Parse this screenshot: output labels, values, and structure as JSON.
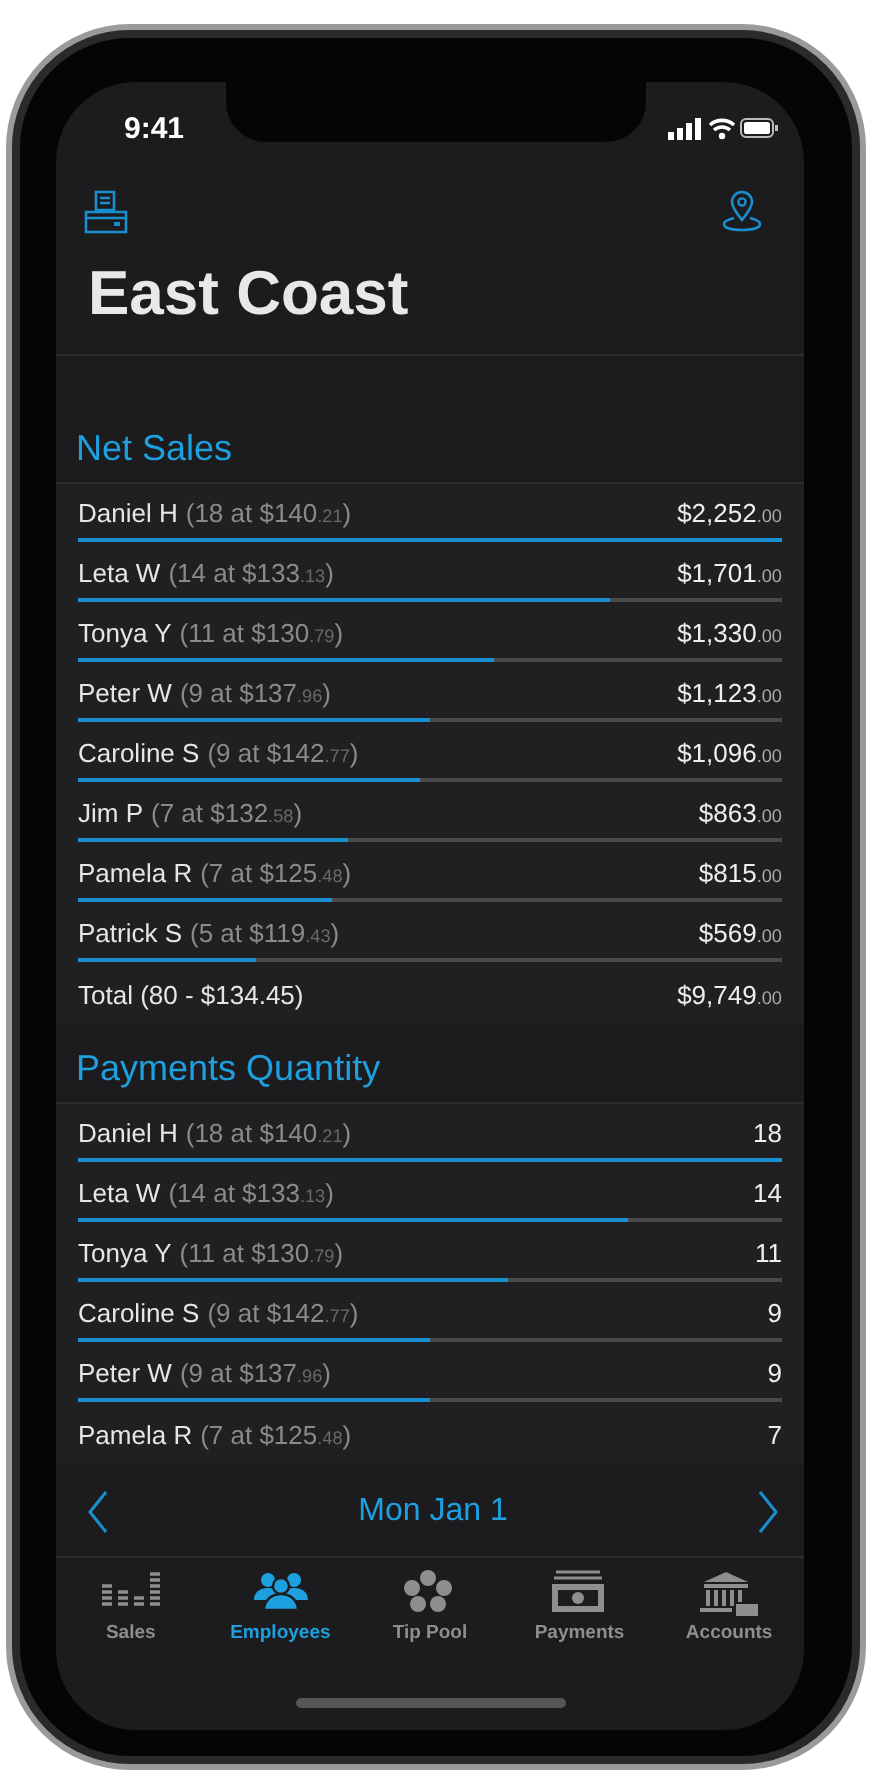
{
  "status_bar": {
    "time": "9:41"
  },
  "title": "East Coast",
  "sections": [
    {
      "title": "Net Sales",
      "rows": [
        {
          "name": "Daniel H",
          "detail": "(18 at $140$_{.21}$)",
          "value": "$2,252$_{.00}$",
          "level": 1
        },
        {
          "name": "Leta W",
          "detail": "(14 at $133$_{.13}$)",
          "value": "$1,701$_{.00}$",
          "level": 0.755
        },
        {
          "name": "Tonya Y",
          "detail": "(11 at $130$_{.79}$)",
          "value": "$1,330$_{.00}$",
          "level": 0.59
        },
        {
          "name": "Peter W",
          "detail": "(9 at $137$_{.96}$)",
          "value": "$1,123$_{.00}$",
          "level": 0.5
        },
        {
          "name": "Caroline S",
          "detail": "(9 at $142$_{.77}$)",
          "value": "$1,096$_{.00}$",
          "level": 0.487
        },
        {
          "name": "Jim P",
          "detail": "(7 at $132$_{.58}$)",
          "value": "$863$_{.00}$",
          "level": 0.383
        },
        {
          "name": "Pamela R",
          "detail": "(7 at $125$_{.48}$)",
          "value": "$815$_{.00}$",
          "level": 0.362
        },
        {
          "name": "Patrick S",
          "detail": "(5 at $119$_{.43}$)",
          "value": "$569$_{.00}$",
          "level": 0.253
        },
        {
          "name": "Total (80 - $134.45)",
          "value": "$9,749$_{.00}$"
        }
      ]
    },
    {
      "title": "Payments Quantity",
      "rows": [
        {
          "name": "Daniel H",
          "detail": "(18 at $140$_{.21}$)",
          "value": "18",
          "level": 1
        },
        {
          "name": "Leta W",
          "detail": "(14 at $133$_{.13}$)",
          "value": "14",
          "level": 0.78
        },
        {
          "name": "Tonya Y",
          "detail": "(11 at $130$_{.79}$)",
          "value": "11",
          "level": 0.61
        },
        {
          "name": "Caroline S",
          "detail": "(9 at $142$_{.77}$)",
          "value": "9",
          "level": 0.5
        },
        {
          "name": "Peter W",
          "detail": "(9 at $137$_{.96}$)",
          "value": "9",
          "level": 0.5
        },
        {
          "name": "Pamela R",
          "detail": "(7 at $125$_{.48}$)",
          "value": "7"
        }
      ]
    }
  ],
  "date_bar": {
    "label": "Mon Jan 1"
  },
  "tabs": [
    {
      "kind": "sales",
      "label": "Sales",
      "selected": false
    },
    {
      "kind": "employees",
      "label": "Employees",
      "selected": true
    },
    {
      "kind": "tippool",
      "label": "Tip Pool",
      "selected": false
    },
    {
      "kind": "payments",
      "label": "Payments",
      "selected": false
    },
    {
      "kind": "accounts",
      "label": "Accounts",
      "selected": false
    }
  ]
}
